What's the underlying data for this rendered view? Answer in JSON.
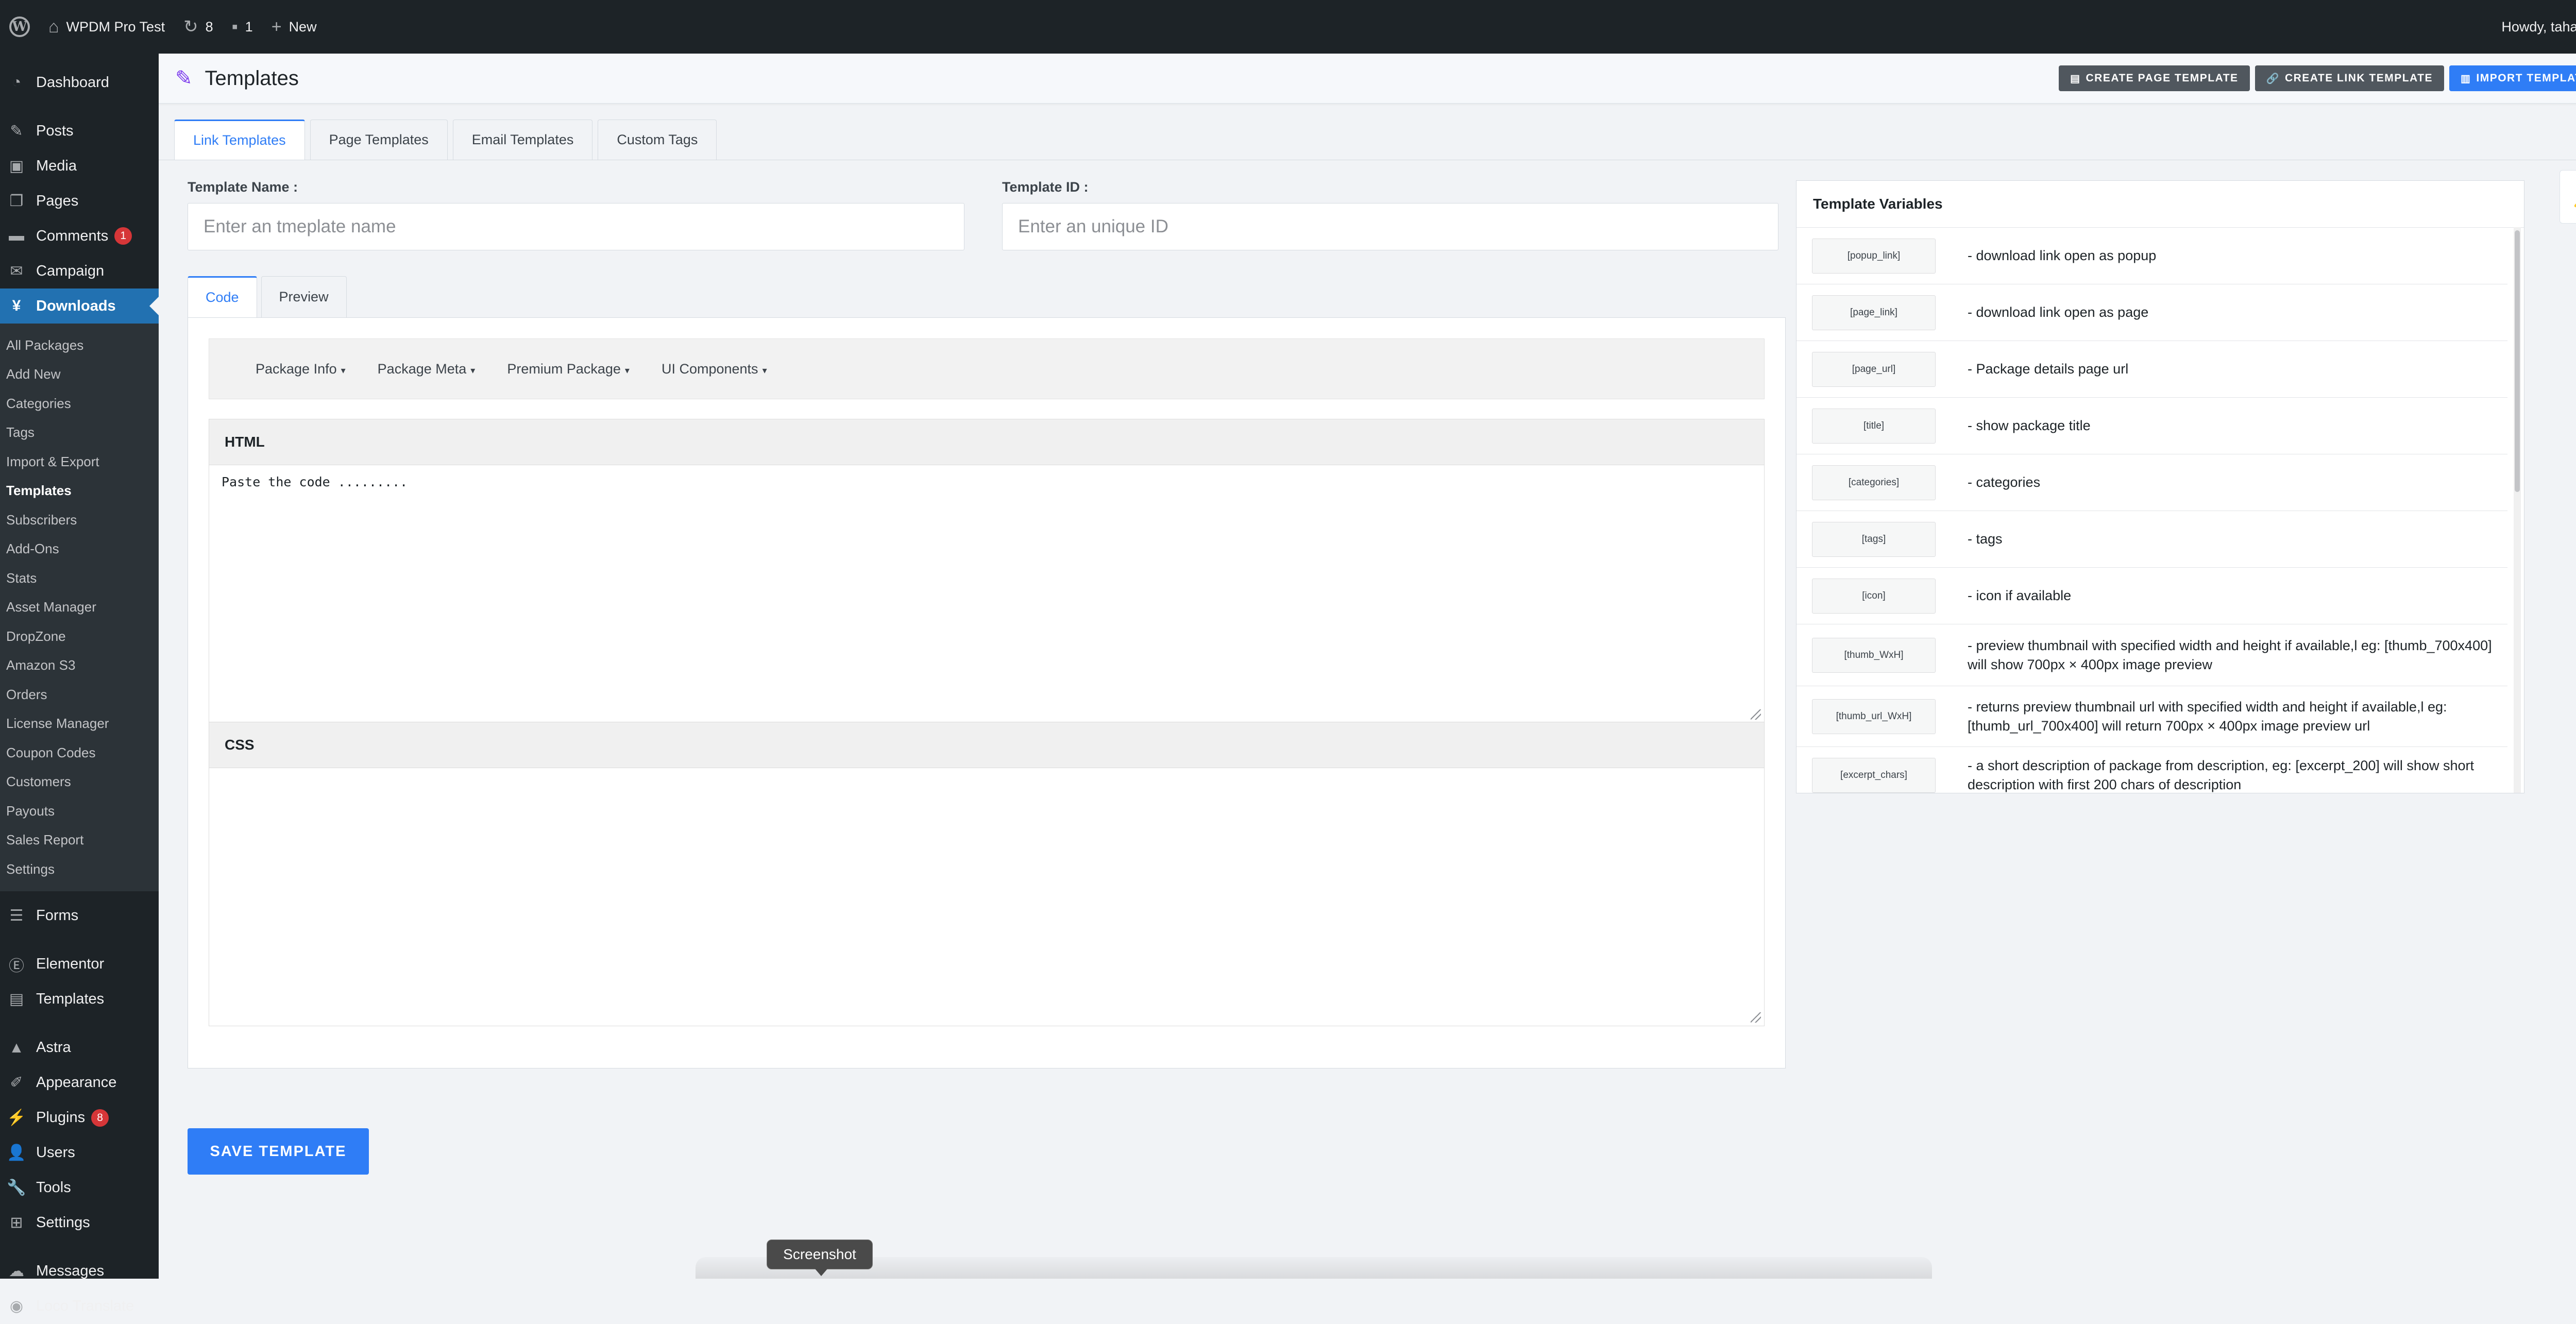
{
  "admin_bar": {
    "site_name": "WPDM Pro Test",
    "updates_count": "8",
    "comments_count": "1",
    "new_label": "New",
    "greeting": "Howdy, tahasin"
  },
  "sidebar": {
    "top_items": [
      {
        "label": "Dashboard",
        "icon": "dashboard-icon"
      },
      {
        "label": "Posts",
        "icon": "pushpin-icon"
      },
      {
        "label": "Media",
        "icon": "media-icon"
      },
      {
        "label": "Pages",
        "icon": "pages-icon"
      },
      {
        "label": "Comments",
        "icon": "comment-icon",
        "badge": "1"
      },
      {
        "label": "Campaign",
        "icon": "mail-icon"
      }
    ],
    "downloads": {
      "label": "Downloads",
      "icon": "downloads-icon"
    },
    "sub_items": [
      "All Packages",
      "Add New",
      "Categories",
      "Tags",
      "Import & Export",
      "Templates",
      "Subscribers",
      "Add-Ons",
      "Stats",
      "Asset Manager",
      "DropZone",
      "Amazon S3",
      "Orders",
      "License Manager",
      "Coupon Codes",
      "Customers",
      "Payouts",
      "Sales Report",
      "Settings"
    ],
    "bottom_items": [
      {
        "label": "Forms",
        "icon": "forms-icon"
      },
      {
        "label": "Elementor",
        "icon": "elementor-icon"
      },
      {
        "label": "Templates",
        "icon": "folder-icon"
      },
      {
        "label": "Astra",
        "icon": "astra-icon"
      },
      {
        "label": "Appearance",
        "icon": "brush-icon"
      },
      {
        "label": "Plugins",
        "icon": "plugin-icon",
        "badge": "8"
      },
      {
        "label": "Users",
        "icon": "users-icon"
      },
      {
        "label": "Tools",
        "icon": "wrench-icon"
      },
      {
        "label": "Settings",
        "icon": "settings-icon"
      },
      {
        "label": "Messages",
        "icon": "messages-icon"
      },
      {
        "label": "Loco Translate",
        "icon": "translate-icon"
      }
    ]
  },
  "header": {
    "title": "Templates",
    "buttons": {
      "create_page": "CREATE PAGE TEMPLATE",
      "create_link": "CREATE LINK TEMPLATE",
      "import": "IMPORT TEMPLATE"
    }
  },
  "tabs": [
    "Link Templates",
    "Page Templates",
    "Email Templates",
    "Custom Tags"
  ],
  "form": {
    "name_label": "Template Name :",
    "name_placeholder": "Enter an tmeplate name",
    "id_label": "Template ID :",
    "id_placeholder": "Enter an unique ID"
  },
  "editor": {
    "sub_tabs": [
      "Code",
      "Preview"
    ],
    "toolbar": [
      "Package Info",
      "Package Meta",
      "Premium Package",
      "UI Components"
    ],
    "html_label": "HTML",
    "html_placeholder": "Paste the code .........",
    "css_label": "CSS",
    "save_label": "SAVE TEMPLATE"
  },
  "variables": {
    "title": "Template Variables",
    "rows": [
      {
        "tag": "[popup_link]",
        "desc": "- download link open as popup"
      },
      {
        "tag": "[page_link]",
        "desc": "- download link open as page"
      },
      {
        "tag": "[page_url]",
        "desc": "- Package details page url"
      },
      {
        "tag": "[title]",
        "desc": "- show package title"
      },
      {
        "tag": "[categories]",
        "desc": "- categories"
      },
      {
        "tag": "[tags]",
        "desc": "- tags"
      },
      {
        "tag": "[icon]",
        "desc": "- icon if available"
      },
      {
        "tag": "[thumb_WxH]",
        "desc": "- preview thumbnail with specified width and height if available,l eg: [thumb_700x400] will show 700px × 400px image preview"
      },
      {
        "tag": "[thumb_url_WxH]",
        "desc": "- returns preview thumbnail url with specified width and height if available,l eg: [thumb_url_700x400] will return 700px × 400px image preview url"
      },
      {
        "tag": "[excerpt_chars]",
        "desc": "- a short description of package from description, eg: [excerpt_200] will show short description with first 200 chars of description"
      }
    ]
  },
  "notification": {
    "count": "0"
  },
  "tooltip": {
    "label": "Screenshot"
  }
}
